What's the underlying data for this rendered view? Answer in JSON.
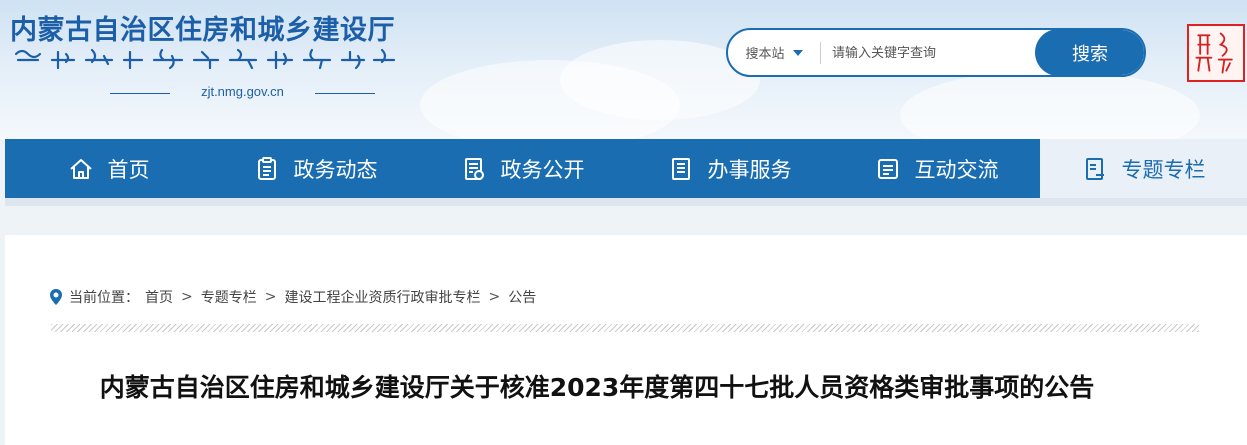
{
  "header": {
    "site_title": "内蒙古自治区住房和城乡建设厅",
    "domain": "zjt.nmg.gov.cn",
    "emblem_icon": "mongolian-seal-icon"
  },
  "search": {
    "scope_label": "搜本站",
    "placeholder": "请输入关键字查询",
    "button_label": "搜索"
  },
  "nav": {
    "items": [
      {
        "label": "首页",
        "icon": "home-icon"
      },
      {
        "label": "政务动态",
        "icon": "clipboard-icon"
      },
      {
        "label": "政务公开",
        "icon": "document-icon"
      },
      {
        "label": "办事服务",
        "icon": "service-icon"
      },
      {
        "label": "互动交流",
        "icon": "chat-icon"
      },
      {
        "label": "专题专栏",
        "icon": "topic-icon"
      }
    ],
    "active_index": 5
  },
  "breadcrumb": {
    "prefix": "当前位置：",
    "items": [
      "首页",
      "专题专栏",
      "建设工程企业资质行政审批专栏",
      "公告"
    ]
  },
  "article": {
    "title": "内蒙古自治区住房和城乡建设厅关于核准2023年度第四十七批人员资格类审批事项的公告"
  },
  "colors": {
    "brand_blue": "#1b6db2",
    "title_blue": "#1c5fa8",
    "seal_red": "#d22222"
  }
}
